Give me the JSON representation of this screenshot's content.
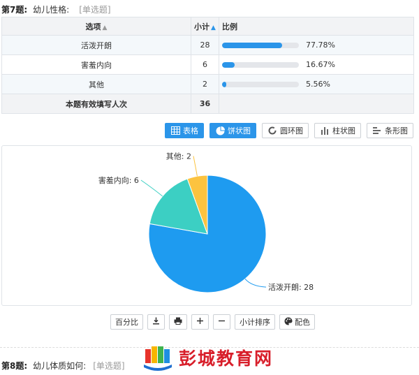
{
  "question": {
    "number": "第7题:",
    "text": "幼儿性格:",
    "type": "[单选题]"
  },
  "table": {
    "headers": {
      "option": "选项",
      "count": "小计",
      "ratio": "比例"
    },
    "rows": [
      {
        "option": "活泼开朗",
        "count": "28",
        "percent": "77.78%",
        "fraction": 0.7778
      },
      {
        "option": "害羞内向",
        "count": "6",
        "percent": "16.67%",
        "fraction": 0.1667
      },
      {
        "option": "其他",
        "count": "2",
        "percent": "5.56%",
        "fraction": 0.0556
      }
    ],
    "footer": {
      "label": "本题有效填写人次",
      "count": "36"
    }
  },
  "view_buttons": [
    {
      "label": "表格",
      "icon": "table-icon",
      "active": true
    },
    {
      "label": "饼状图",
      "icon": "pie-chart-icon",
      "active": true
    },
    {
      "label": "圆环图",
      "icon": "donut-chart-icon",
      "active": false
    },
    {
      "label": "柱状图",
      "icon": "bar-chart-icon",
      "active": false
    },
    {
      "label": "条形图",
      "icon": "horizontal-bar-chart-icon",
      "active": false
    }
  ],
  "chart_data": {
    "type": "pie",
    "slices": [
      {
        "label": "活泼开朗",
        "value": 28,
        "color": "#1e9bf0",
        "display": "活泼开朗: 28"
      },
      {
        "label": "害羞内向",
        "value": 6,
        "color": "#3ccfc3",
        "display": "害羞内向: 6"
      },
      {
        "label": "其他",
        "value": 2,
        "color": "#fcc33f",
        "display": "其他: 2"
      }
    ]
  },
  "toolbar": {
    "percent_label": "百分比",
    "sort_label": "小计排序",
    "color_label": "配色"
  },
  "next_question": {
    "number": "第8题:",
    "text": "幼儿体质如何:",
    "type": "[单选题]"
  },
  "watermark": {
    "text": "彭城教育网"
  },
  "colors": {
    "accent": "#2b95e9",
    "watermark": "#d81e2a"
  }
}
